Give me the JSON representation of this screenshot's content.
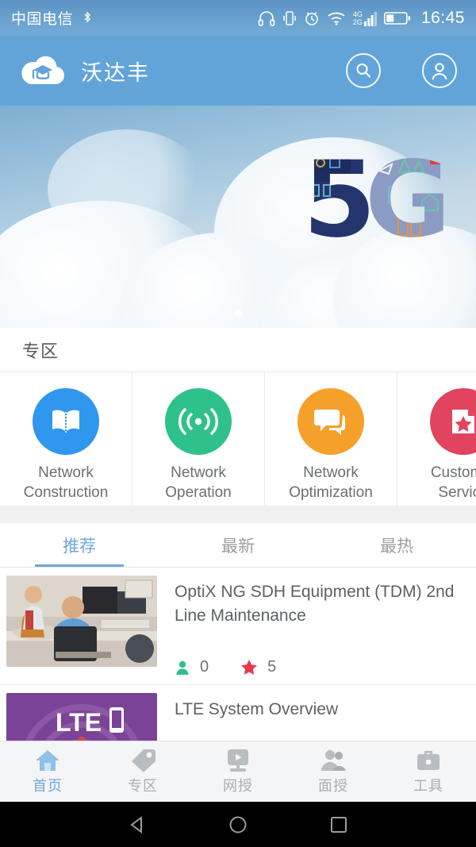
{
  "status_bar": {
    "carrier": "中国电信",
    "time": "16:45",
    "network_primary": "4G",
    "network_secondary": "2G",
    "icons": [
      "bluetooth-icon",
      "headphones-icon",
      "vibrate-icon",
      "alarm-icon",
      "wifi-icon",
      "signal-icon",
      "battery-icon"
    ]
  },
  "appbar": {
    "brand_title": "沃达丰",
    "logo_icon": "cloud-graduation-cap-logo",
    "search_icon": "search-icon",
    "profile_icon": "profile-icon"
  },
  "banner": {
    "headline": "5G",
    "page_indicator_count": 1,
    "active_index": 0
  },
  "zone": {
    "section_title": "专区",
    "tiles": [
      {
        "label": "Network\nConstruction",
        "icon": "open-book-icon",
        "color": "#2f97ed"
      },
      {
        "label": "Network\nOperation",
        "icon": "broadcast-signal-icon",
        "color": "#2ec18a"
      },
      {
        "label": "Network\nOptimization",
        "icon": "chat-bubbles-icon",
        "color": "#f6a02c"
      },
      {
        "label": "Customer\nService",
        "icon": "document-star-icon",
        "color": "#e2435f"
      }
    ]
  },
  "content_tabs": {
    "items": [
      {
        "label": "推荐",
        "active": true
      },
      {
        "label": "最新",
        "active": false
      },
      {
        "label": "最热",
        "active": false
      }
    ]
  },
  "courses": [
    {
      "title": "OptiX NG SDH Equipment (TDM) 2nd Line Maintenance",
      "thumbnail": "office-computers-photo",
      "learners_icon": "person-icon",
      "learners": "0",
      "rating_icon": "star-icon",
      "rating": "5"
    },
    {
      "title": "LTE System Overview",
      "thumbnail": "lte-purple-graphic",
      "thumbnail_text": "LTE"
    }
  ],
  "bottom_nav": {
    "items": [
      {
        "label": "首页",
        "icon": "home-icon",
        "active": true
      },
      {
        "label": "专区",
        "icon": "tag-icon",
        "active": false
      },
      {
        "label": "网授",
        "icon": "monitor-play-icon",
        "active": false
      },
      {
        "label": "面授",
        "icon": "people-icon",
        "active": false
      },
      {
        "label": "工具",
        "icon": "briefcase-icon",
        "active": false
      }
    ]
  },
  "system_nav": {
    "back_icon": "back-triangle-icon",
    "home_icon": "home-circle-icon",
    "recents_icon": "recents-square-icon"
  },
  "colors": {
    "accent": "#6fa8d6",
    "appbar": "#62a4d8",
    "star": "#e8384f",
    "learner": "#2ec18a"
  }
}
